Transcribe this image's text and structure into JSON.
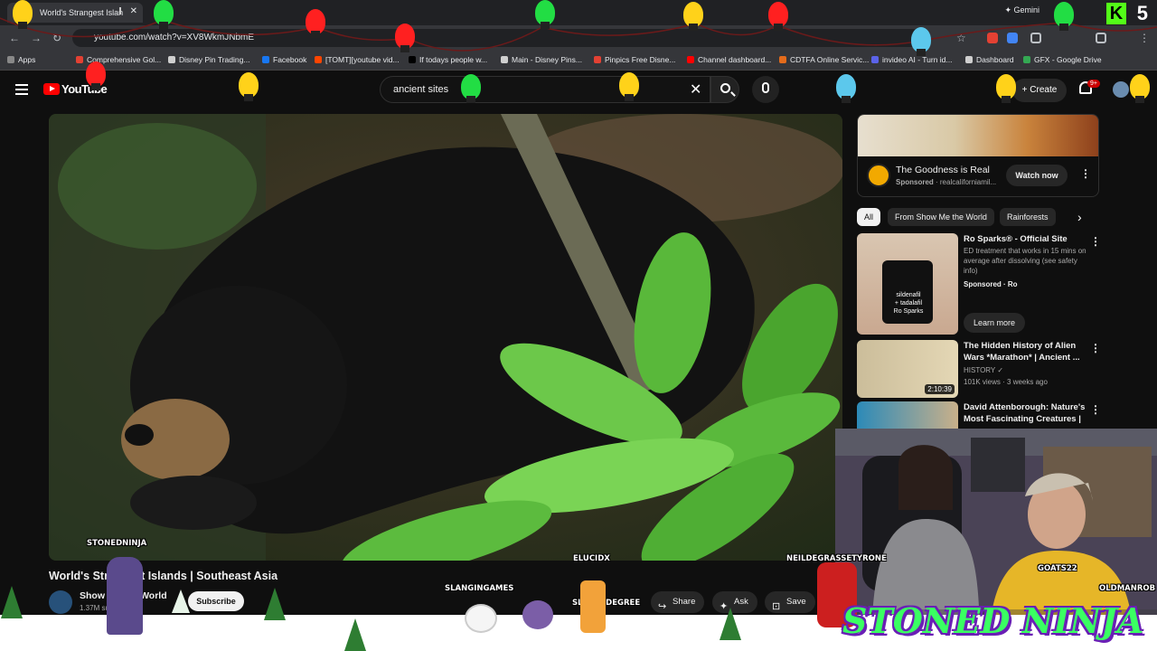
{
  "browser": {
    "tab_title": "World's Strangest Islan",
    "url": "youtube.com/watch?v=XV8WkmJNbmE",
    "gemini_label": "Gemini",
    "bookmarks": [
      "Apps",
      "Comprehensive Gol...",
      "Disney Pin Trading...",
      "Facebook",
      "[TOMT][youtube vid...",
      "If todays people w...",
      "Main - Disney Pins...",
      "Pinpics Free Disne...",
      "Channel dashboard...",
      "CDTFA Online Servic...",
      "invideo AI - Turn id...",
      "Dashboard",
      "GFX - Google Drive"
    ],
    "bookmark_colors": [
      "#888888",
      "#e34133",
      "#cfcfcf",
      "#1877f2",
      "#ff4500",
      "#000000",
      "#cfcfcf",
      "#e34133",
      "#ff0000",
      "#e46b1b",
      "#5b63e8",
      "#cfcfcf",
      "#34a853"
    ]
  },
  "youtube": {
    "logo_text": "YouTube",
    "search_value": "ancient sites",
    "create_label": "Create",
    "notification_count": "9+"
  },
  "video": {
    "title": "World's Strangest Islands | Southeast Asia",
    "channel": "Show Me the World",
    "subs": "1.37M subscribers",
    "subscribe_label": "Subscribe",
    "share_label": "Share",
    "ask_label": "Ask",
    "save_label": "Save"
  },
  "ad": {
    "title": "The Goodness is Real",
    "sponsored": "Sponsored",
    "advertiser": "realcaliforniamil...",
    "cta": "Watch now"
  },
  "chips": [
    "All",
    "From Show Me the World",
    "Rainforests"
  ],
  "recs": [
    {
      "title": "Ro Sparks® - Official Site",
      "desc": "ED treatment that works in 15 mins on average after dissolving (see safety info)",
      "meta": "Sponsored · Ro",
      "cta": "Learn more",
      "thumb_text": [
        "sildenafil",
        "+ tadalafil",
        "Ro Sparks"
      ]
    },
    {
      "title": "The Hidden History of Alien Wars *Marathon* | Ancient ...",
      "channel": "HISTORY",
      "meta": "101K views · 3 weeks ago",
      "duration": "2:10:39"
    },
    {
      "title": "David Attenborough: Nature's Most Fascinating Creatures | ...",
      "channel": "",
      "meta": "",
      "duration": ""
    }
  ],
  "overlay": {
    "names": [
      "STONEDNINJA",
      "ELUCIDX",
      "NEILDEGRASSETYRONE",
      "SLANGINGAMES",
      "SLEUENDEGREE",
      "GOATS22",
      "OLDMANROB"
    ],
    "brand": "STONED NINJA",
    "brand_color": "#3aff62"
  }
}
